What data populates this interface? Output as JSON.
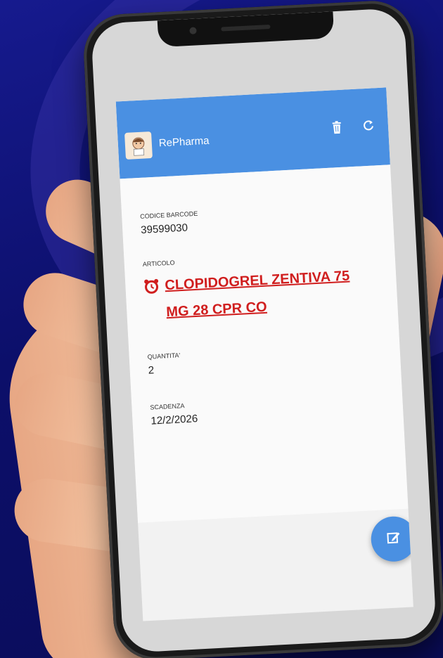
{
  "app": {
    "title": "RePharma",
    "header_color": "#4a90e2",
    "logo_icon": "pharmacist-avatar-icon",
    "actions": [
      {
        "name": "delete",
        "icon": "trash-icon"
      },
      {
        "name": "refresh",
        "icon": "refresh-icon"
      }
    ]
  },
  "fields": {
    "barcode": {
      "label": "CODICE BARCODE",
      "value": "39599030"
    },
    "articolo": {
      "label": "ARTICOLO",
      "value": "CLOPIDOGREL ZENTIVA 75 MG 28 CPR CO",
      "color": "#d01e1e",
      "icon": "alarm-clock-icon"
    },
    "quantita": {
      "label": "QUANTITA'",
      "value": "2"
    },
    "scadenza": {
      "label": "SCADENZA",
      "value": "12/2/2026"
    }
  },
  "fab": {
    "icon": "edit-icon"
  }
}
